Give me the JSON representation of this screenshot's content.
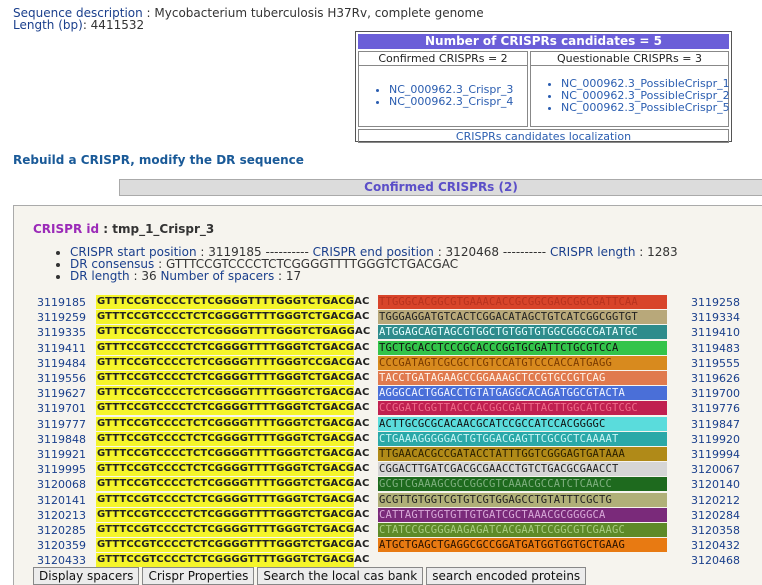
{
  "header": {
    "seq_desc_label": "Sequence description",
    "seq_desc_value": "Mycobacterium tuberculosis H37Rv, complete genome",
    "length_label": "Length (bp)",
    "length_value": "4411532"
  },
  "candidates": {
    "title": "Number of CRISPRs candidates = 5",
    "confirmed_header": "Confirmed CRISPRs = 2",
    "questionable_header": "Questionable CRISPRs = 3",
    "confirmed": [
      "NC_000962.3_Crispr_3",
      "NC_000962.3_Crispr_4"
    ],
    "questionable": [
      "NC_000962.3_PossibleCrispr_1",
      "NC_000962.3_PossibleCrispr_2",
      "NC_000962.3_PossibleCrispr_5"
    ],
    "localization_link": "CRISPRs candidates localization"
  },
  "rebuild_link": "Rebuild a CRISPR, modify the DR sequence",
  "confirmed_bar": "Confirmed CRISPRs (2)",
  "crispr": {
    "id_label": "CRISPR id",
    "id_value": "tmp_1_Crispr_3",
    "start_label": "CRISPR start position",
    "start_value": "3119185",
    "sep": "----------",
    "end_label": "CRISPR end position",
    "end_value": "3120468",
    "len_label": "CRISPR length",
    "len_value": "1283",
    "dr_cons_label": "DR consensus",
    "dr_cons_value": "GTTTCCGTCCCCTCTCGGGGTTTTGGGTCTGACGAC",
    "dr_len_label": "DR length",
    "dr_len_value": "36",
    "nspacers_label": "Number of spacers",
    "nspacers_value": "17"
  },
  "rows": [
    {
      "start": "3119185",
      "dr": "GTTTCCGTCCCCTCTCGGGGTTTTGGGTCTGACGAC",
      "spacer": "TTGGGCACGGCGTGAAACACCGCGGCGAGCGGCGATTCAA",
      "color": "#d8442a",
      "text": "#b8321e",
      "end": "3119258"
    },
    {
      "start": "3119259",
      "dr": "GTTTCCGTCCCCTCTCGGGGTTTTGGGTCTGACGAC",
      "spacer": "TGGGAGGATGTCACTCGGACATAGCTGTCATCGGCGGTGT",
      "color": "#b8a87a",
      "text": "#222",
      "end": "3119334"
    },
    {
      "start": "3119335",
      "dr": "GTTTCCGTCCCCTCTCGGGGTTTTGGGTCTGAGGAC",
      "spacer": "ATGGAGCAGTAGCGTGGCTGTGGTGTGGCGGGCGATATGC",
      "color": "#2e8c8c",
      "text": "#e8ffff",
      "end": "3119410"
    },
    {
      "start": "3119411",
      "dr": "GTTTCCGTCCCCTCTCGGGGTTTTGGGTCTGACGAC",
      "spacer": "TGCTGCACCTCCCGCACCCGGTGCGATTCTGCGTCCA",
      "color": "#33c44a",
      "text": "#111",
      "end": "3119483"
    },
    {
      "start": "3119484",
      "dr": "GTTTCCGTCCCCTCTCGGGGTTTTGGGTCCGACGAC",
      "spacer": "CCCGATAGTCGCGCTCGTCCATGTCCCACCATGAGG",
      "color": "#d88a1e",
      "text": "#7a3b00",
      "end": "3119555"
    },
    {
      "start": "3119556",
      "dr": "GTTTCCGTCCCCTCTCGGGGTTTTGGGTCTGACGAC",
      "spacer": "TACCTGATAGAAGCCGGAAAGCTCCGTGCCGTCAG",
      "color": "#e07a4e",
      "text": "#fff3e8",
      "end": "3119626"
    },
    {
      "start": "3119627",
      "dr": "GTTTCCGTCCCCTCTCGGGGTTTTGGGTCTGACGAC",
      "spacer": "AGGGCACTGGACCTGTATGAGGCACAGATGGCGTACTA",
      "color": "#4a6fd8",
      "text": "#f0f4ff",
      "end": "3119700"
    },
    {
      "start": "3119701",
      "dr": "GTTTCCGTCCCCTCTCGGGGTTTTGGGTCTGACGAC",
      "spacer": "CCGGATCGGTTACCCACGGCGATTTACTTGGCATCGTCGC",
      "color": "#c02050",
      "text": "#ee6a8a",
      "end": "3119776"
    },
    {
      "start": "3119777",
      "dr": "GTTTCCGTCCCCTCTCGGGGTTTTGGGTCTGACGAC",
      "spacer": "ACTTGCGCGCACAACGCATCCGCCATCCACGGGGC",
      "color": "#5adcdc",
      "text": "#111",
      "end": "3119847"
    },
    {
      "start": "3119848",
      "dr": "GTTTCCGTCCCCTCTCGGGGTTTTGGGTCTGACGAC",
      "spacer": "CTGAAAGGGGGACTGTGGACGAGTTCGCGCTCAAAAT",
      "color": "#2aa8a8",
      "text": "#c8f6f6",
      "end": "3119920"
    },
    {
      "start": "3119921",
      "dr": "GTTTCCGTCCCCTCTCGGGGTTTTGGGTCTGACGAC",
      "spacer": "TTGAACACGCCGATACCTATTTGGTCGGGAGTGATAAA",
      "color": "#b08a18",
      "text": "#2a1f00",
      "end": "3119994"
    },
    {
      "start": "3119995",
      "dr": "GTTTCCGTCCCCTCTCGGGGTTTTGGGTCTGACGAC",
      "spacer": "CGGACTTGATCGACGCGAACCTGTCTGACGCGAACCT",
      "color": "#d6d6d6",
      "text": "#222",
      "end": "3120067"
    },
    {
      "start": "3120068",
      "dr": "GTTTCCGTCCCCTCTCGGGGTTTTGGGTCTGACGAC",
      "spacer": "GCGTCGAAAGCGCCGGCGTCAAACGCCATCTCAACC",
      "color": "#1e6a1e",
      "text": "#7fb07f",
      "end": "3120140"
    },
    {
      "start": "3120141",
      "dr": "GTTTCCGTCCCCTCTCGGGGTTTTGGGTCTGACGAC",
      "spacer": "GCGTTGTGGTCGTGTCGTGGAGCCTGTATTTCGCTG",
      "color": "#b0b078",
      "text": "#222",
      "end": "3120212"
    },
    {
      "start": "3120213",
      "dr": "GTTTCCGTCCCCTCTCGGGGTTTTGGGTCTGACGAC",
      "spacer": "CATTAGTTGGTGTTGTGATCGCTAAACGCGGGGCA",
      "color": "#7a2a7a",
      "text": "#d8a8d8",
      "end": "3120284"
    },
    {
      "start": "3120285",
      "dr": "GTTTCCGTCCCCTCTCGGGGTTTTGGGTCTGACGAC",
      "spacer": "CTATCCGCGGGAAGAGATCACGAATCCGGCGTCGAAGC",
      "color": "#5e8a28",
      "text": "#a8cc80",
      "end": "3120358"
    },
    {
      "start": "3120359",
      "dr": "GTTTCCGTCCCCTCTCGGGGTTTTGGGTCTGACGAC",
      "spacer": "ATGCTGAGCTGAGGCGCCGGATGATGGTGGTGCTGAAG",
      "color": "#e87a12",
      "text": "#2a1200",
      "end": "3120432"
    },
    {
      "start": "3120433",
      "dr": "GTTTCCGTCCCCTCTCGGGGTTTTGGGTCTGACGAC",
      "spacer": "",
      "color": "",
      "text": "",
      "end": "3120468"
    }
  ],
  "buttons": [
    "Display spacers",
    "Crispr Properties",
    "Search the local cas bank",
    "search encoded proteins"
  ]
}
